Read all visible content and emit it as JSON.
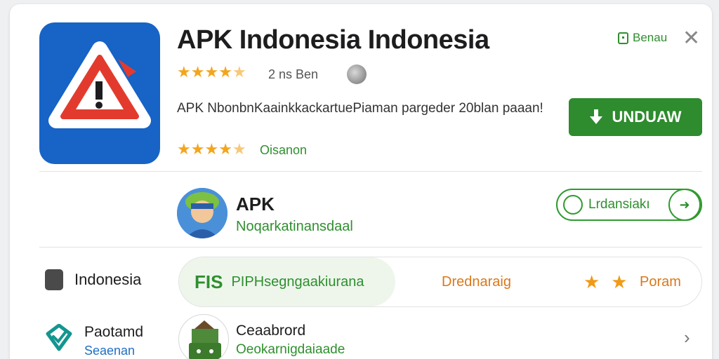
{
  "header": {
    "app_title": "APK Indonesia Indonesia",
    "rating_stars": 4.5,
    "rating_meta": "2 ns Ben",
    "save_label": "Benau",
    "description": "APK NbonbnKaainkkackartuePiaman pargeder 20blan paaan!",
    "second_rating_stars": 4.5,
    "second_rating_label": "Oisanon",
    "install_label": "UNDUAW"
  },
  "developer": {
    "name": "APK",
    "subtitle": "Noqarkatinansdaal",
    "follow_label": "Lrdansiakı"
  },
  "category": {
    "label": "Indonesia"
  },
  "tags": {
    "code": "FIS",
    "green_text": "PIPHsegngaakiurana",
    "orange_text": "Drednaraig",
    "popular_label": "Poram"
  },
  "nav": {
    "label": "Paotamd",
    "sub": "Seaenan"
  },
  "related_app": {
    "name": "Ceaabrord",
    "subtitle": "Oeokarnigdaiaade"
  },
  "colors": {
    "brand_green": "#2e8b2e",
    "star_gold": "#f4a51c",
    "icon_blue": "#1763c6",
    "tag_orange": "#d9781b"
  }
}
